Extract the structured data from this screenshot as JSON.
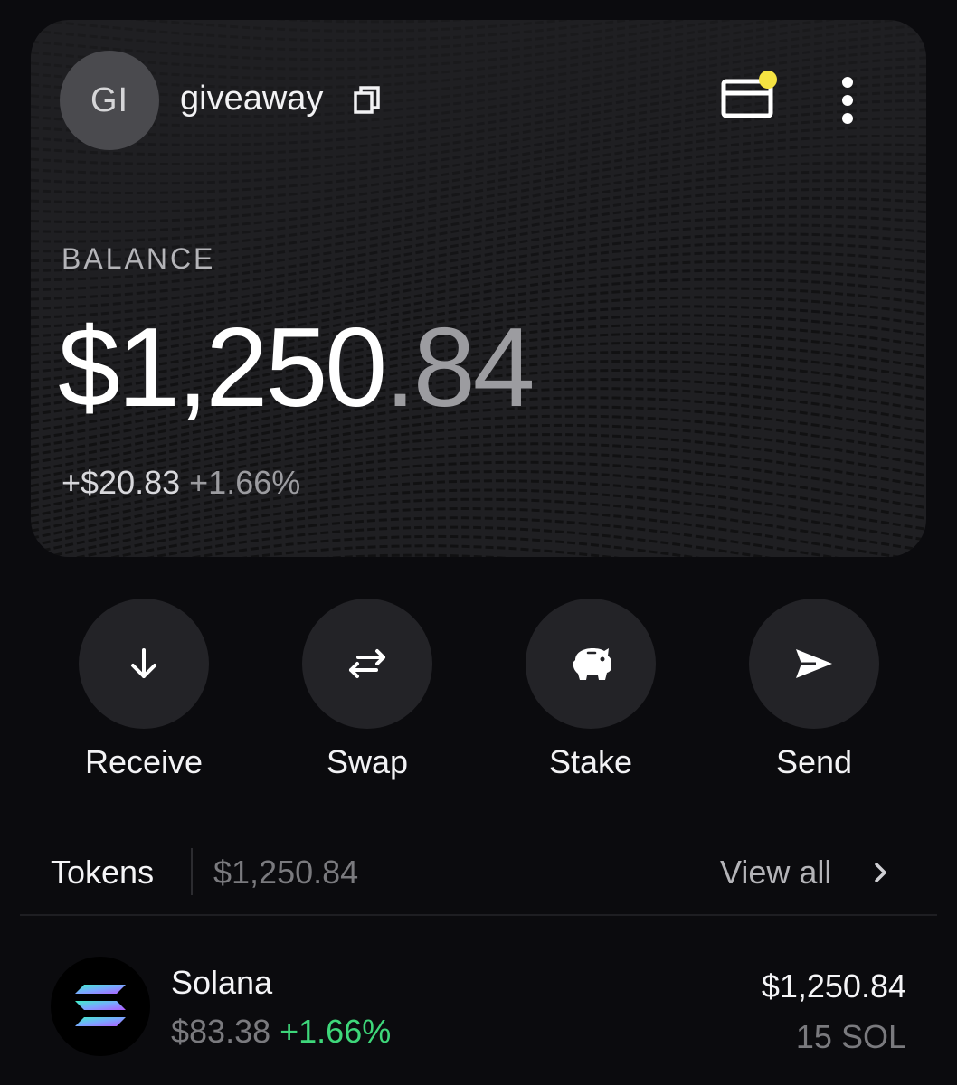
{
  "wallet": {
    "avatar_initials": "GI",
    "name": "giveaway"
  },
  "balance": {
    "label": "BALANCE",
    "whole": "$1,250",
    "cents": ".84",
    "change_abs": "+$20.83",
    "change_pct": "+1.66%"
  },
  "actions": [
    {
      "label": "Receive",
      "icon": "arrow-down-icon"
    },
    {
      "label": "Swap",
      "icon": "swap-arrows-icon"
    },
    {
      "label": "Stake",
      "icon": "piggy-bank-icon"
    },
    {
      "label": "Send",
      "icon": "send-icon"
    }
  ],
  "tokens": {
    "title": "Tokens",
    "total": "$1,250.84",
    "view_all": "View all",
    "items": [
      {
        "name": "Solana",
        "price": "$83.38",
        "change_pct": "+1.66%",
        "value": "$1,250.84",
        "amount": "15 SOL",
        "icon": "solana-logo-icon"
      }
    ]
  },
  "colors": {
    "background": "#0b0b0e",
    "card": "#1f1f22",
    "positive": "#3ed77a",
    "notification_dot": "#f5e342",
    "action_circle": "#232327"
  }
}
